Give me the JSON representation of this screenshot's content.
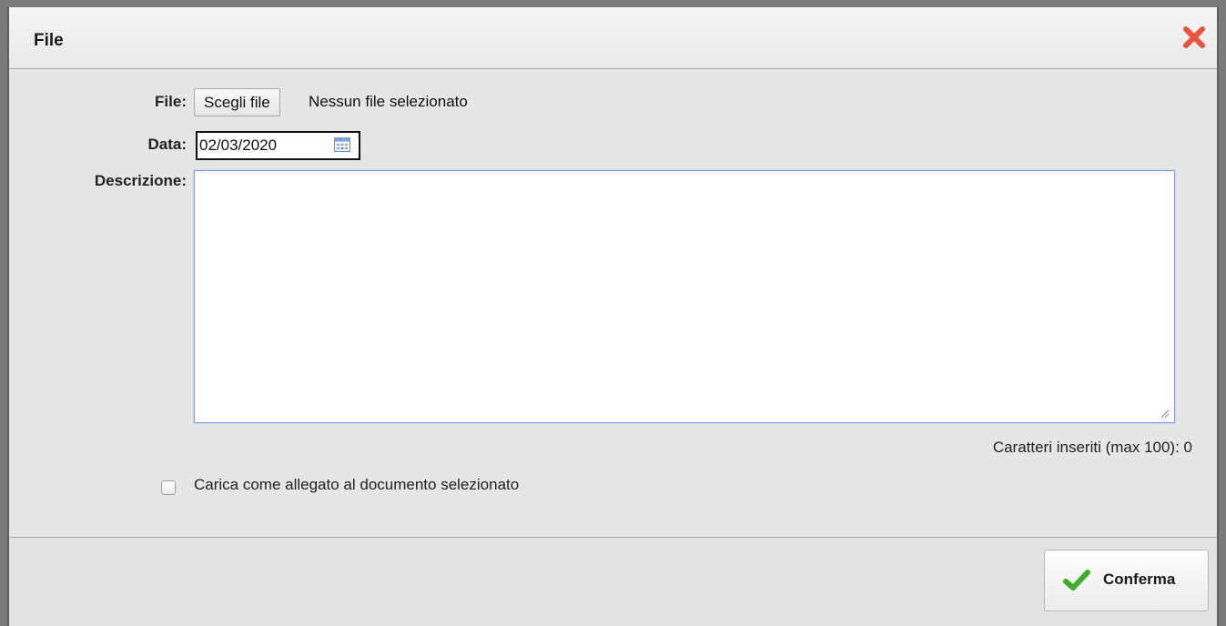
{
  "dialog": {
    "title": "File",
    "close_icon": "close-x-icon",
    "accent_close": "#e8533e"
  },
  "form": {
    "file_label": "File:",
    "file_button": "Scegli file",
    "file_status": "Nessun file selezionato",
    "date_label": "Data:",
    "date_value": "02/03/2020",
    "calendar_icon": "calendar-icon",
    "description_label": "Descrizione:",
    "description_value": "",
    "counter": "Caratteri inseriti (max 100): 0",
    "attach_checkbox_label": "Carica come allegato al documento selezionato",
    "attach_checked": false
  },
  "footer": {
    "confirm_label": "Conferma",
    "confirm_icon": "checkmark-icon",
    "accent_confirm": "#3fae2a"
  }
}
